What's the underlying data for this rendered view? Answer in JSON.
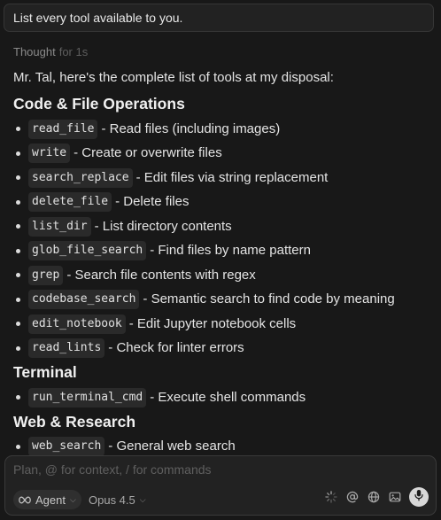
{
  "user_message": "List every tool available to you.",
  "thought": {
    "label": "Thought",
    "duration": "for 1s"
  },
  "response": {
    "intro": "Mr. Tal, here's the complete list of tools at my disposal:",
    "sections": [
      {
        "title": "Code & File Operations",
        "items": [
          {
            "code": "read_file",
            "desc": "- Read files (including images)"
          },
          {
            "code": "write",
            "desc": "- Create or overwrite files"
          },
          {
            "code": "search_replace",
            "desc": "- Edit files via string replacement"
          },
          {
            "code": "delete_file",
            "desc": "- Delete files"
          },
          {
            "code": "list_dir",
            "desc": "- List directory contents"
          },
          {
            "code": "glob_file_search",
            "desc": "- Find files by name pattern"
          },
          {
            "code": "grep",
            "desc": "- Search file contents with regex"
          },
          {
            "code": "codebase_search",
            "desc": "- Semantic search to find code by meaning"
          },
          {
            "code": "edit_notebook",
            "desc": "- Edit Jupyter notebook cells"
          },
          {
            "code": "read_lints",
            "desc": "- Check for linter errors"
          }
        ]
      },
      {
        "title": "Terminal",
        "items": [
          {
            "code": "run_terminal_cmd",
            "desc": "- Execute shell commands"
          }
        ]
      },
      {
        "title": "Web & Research",
        "items": [
          {
            "code": "web_search",
            "desc": "- General web search"
          }
        ]
      }
    ]
  },
  "composer": {
    "placeholder": "Plan, @ for context, / for commands",
    "mode_label": "Agent",
    "model_label": "Opus 4.5",
    "icons": [
      "agent-infinity-icon",
      "loading-spinner-icon",
      "at-mention-icon",
      "globe-icon",
      "image-icon",
      "microphone-icon"
    ]
  }
}
